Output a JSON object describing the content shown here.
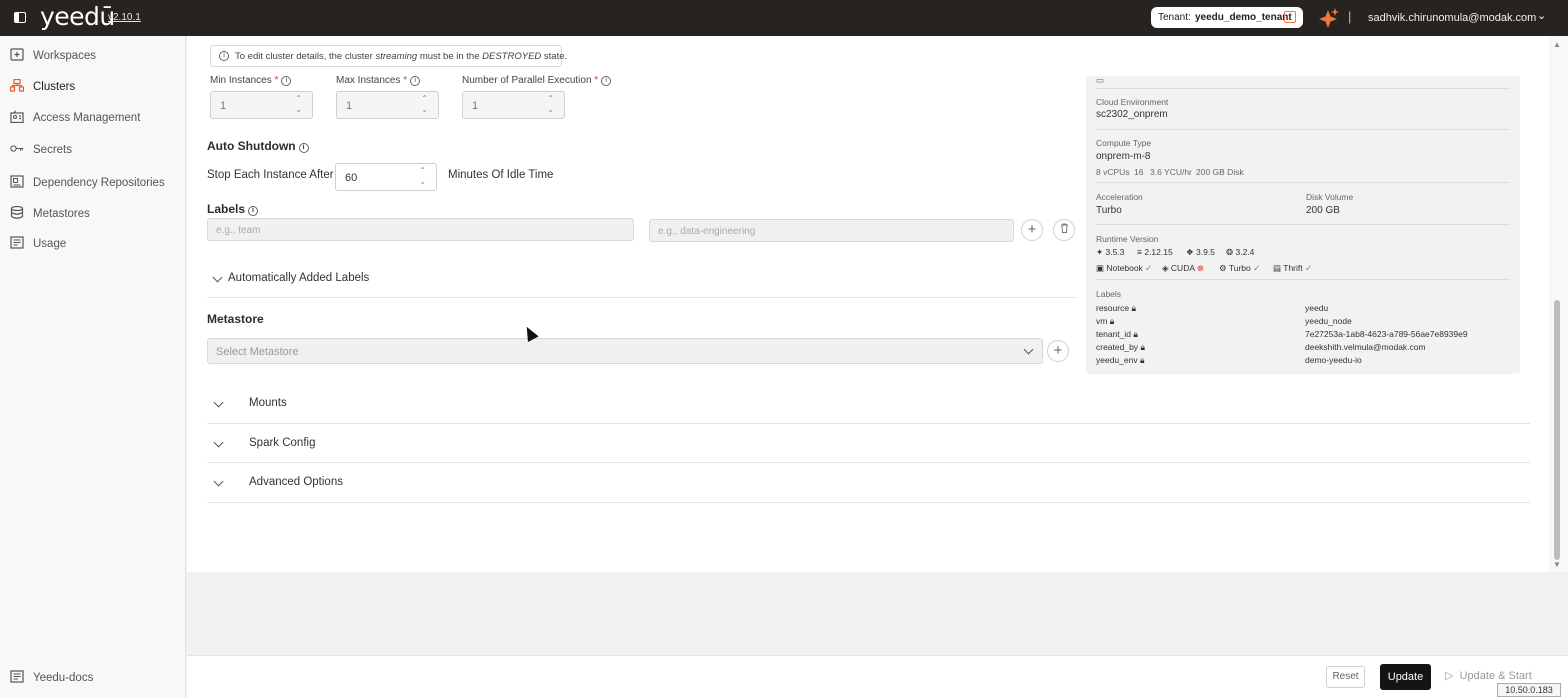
{
  "app": {
    "logo": "yeedū",
    "version": "v2.10.1",
    "tenant_label": "Tenant:",
    "tenant_value": "yeedu_demo_tenant",
    "separator": "|",
    "user_email": "sadhvik.chirunomula@modak.com",
    "accent": "#e0612c"
  },
  "sidebar": {
    "items": [
      {
        "label": "Workspaces",
        "icon": "workspace-icon"
      },
      {
        "label": "Clusters",
        "icon": "cluster-icon",
        "active": true
      },
      {
        "label": "Access Management",
        "icon": "access-icon"
      },
      {
        "label": "Secrets",
        "icon": "key-icon"
      },
      {
        "label": "Dependency Repositories",
        "icon": "repository-icon"
      },
      {
        "label": "Metastores",
        "icon": "database-icon"
      },
      {
        "label": "Usage",
        "icon": "usage-icon"
      }
    ],
    "docs_label": "Yeedu-docs"
  },
  "form": {
    "banner": {
      "prefix": "To edit cluster details, the cluster",
      "cluster_name": "streaming",
      "middle": "must be in the",
      "state": "DESTROYED",
      "suffix": "state."
    },
    "min_instances": {
      "label": "Min Instances",
      "value": "1"
    },
    "max_instances": {
      "label": "Max Instances",
      "value": "1"
    },
    "parallel": {
      "label": "Number of Parallel Execution",
      "value": "1"
    },
    "required_mark": "*",
    "auto_shutdown": {
      "title": "Auto Shutdown",
      "prefix": "Stop Each Instance After",
      "value": "60",
      "suffix": "Minutes Of Idle Time"
    },
    "labels": {
      "title": "Labels",
      "key_placeholder": "e.g., team",
      "value_placeholder": "e.g., data-engineering",
      "auto_added": "Automatically Added Labels"
    },
    "metastore": {
      "title": "Metastore",
      "placeholder": "Select Metastore"
    },
    "sections": [
      "Mounts",
      "Spark Config",
      "Advanced Options"
    ]
  },
  "details": {
    "cloud_env_label": "Cloud Environment",
    "cloud_env_value": "sc2302_onprem",
    "compute_label": "Compute Type",
    "compute_value": "onprem-m-8",
    "compute_specs": [
      "8 vCPUs",
      "16",
      "3.6 YCU/hr",
      "200 GB Disk"
    ],
    "acceleration_label": "Acceleration",
    "acceleration_value": "Turbo",
    "disk_label": "Disk Volume",
    "disk_value": "200 GB",
    "runtime_label": "Runtime Version",
    "runtime_versions": [
      "3.5.3",
      "2.12.15",
      "3.9.5",
      "3.2.4"
    ],
    "features": [
      {
        "name": "Notebook",
        "status": "ok"
      },
      {
        "name": "CUDA",
        "status": "bad"
      },
      {
        "name": "Turbo",
        "status": "ok"
      },
      {
        "name": "Thrift",
        "status": "ok"
      }
    ],
    "labels_label": "Labels",
    "labels": [
      {
        "key": "resource",
        "value": "yeedu"
      },
      {
        "key": "vm",
        "value": "yeedu_node"
      },
      {
        "key": "tenant_id",
        "value": "7e27253a-1ab8-4623-a789-56ae7e8939e9"
      },
      {
        "key": "created_by",
        "value": "deekshith.velmula@modak.com"
      },
      {
        "key": "yeedu_env",
        "value": "demo-yeedu-io"
      }
    ]
  },
  "footer": {
    "reset": "Reset",
    "update": "Update",
    "update_start": "Update & Start",
    "ip": "10.50.0.183"
  }
}
